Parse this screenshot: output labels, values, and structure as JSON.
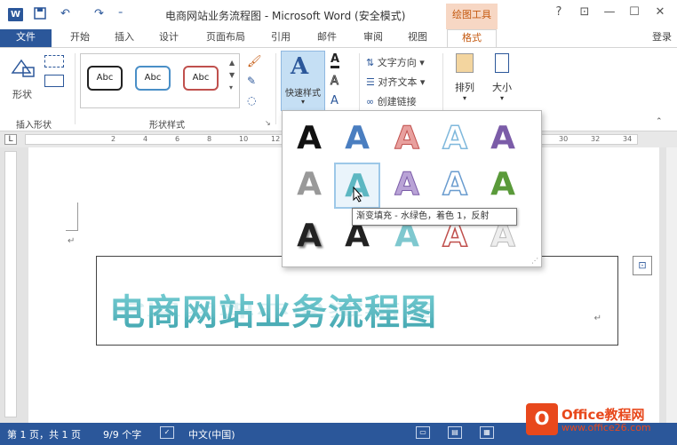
{
  "titlebar": {
    "app_icon": "W",
    "save_icon": "save-icon",
    "undo_icon": "undo-icon",
    "redo_icon": "redo-icon",
    "title": "电商网站业务流程图 - Microsoft Word (安全模式)",
    "contextual_tab": "绘图工具",
    "help": "?",
    "minimize": "—",
    "restore": "☐",
    "close": "✕",
    "ribbon_opts": "⊡"
  },
  "tabs": {
    "file": "文件",
    "items": [
      "开始",
      "插入",
      "设计",
      "页面布局",
      "引用",
      "邮件",
      "审阅",
      "视图"
    ],
    "format": "格式",
    "login": "登录"
  },
  "ribbon": {
    "insert_shape": {
      "shape_label": "形状",
      "group_label": "插入形状"
    },
    "shape_styles": {
      "samples": [
        "Abc",
        "Abc",
        "Abc"
      ],
      "group_label": "形状样式"
    },
    "wordart": {
      "quick_style_label": "快速样式",
      "text_direction": "文字方向",
      "align_text": "对齐文本",
      "create_link": "创建链接"
    },
    "arrange_label": "排列",
    "size_label": "大小",
    "accent_colors": {
      "blue": "#2b579a",
      "orange": "#c55a11"
    }
  },
  "ruler": {
    "corner": "L",
    "ticks": [
      "2",
      "4",
      "6",
      "8",
      "10",
      "12",
      "14",
      "16",
      "18",
      "20",
      "22",
      "24",
      "26",
      "28",
      "30",
      "32",
      "34"
    ]
  },
  "document": {
    "para_mark": "↵",
    "wordart_text": "电商网站业务流程图",
    "box_para_mark": "↵"
  },
  "gallery": {
    "rows": [
      [
        "A",
        "A",
        "A",
        "A",
        "A"
      ],
      [
        "A",
        "A",
        "A",
        "A",
        "A"
      ],
      [
        "A",
        "A",
        "A",
        "A",
        "A"
      ]
    ],
    "tooltip": "渐变填充 - 水绿色，着色 1，反射"
  },
  "statusbar": {
    "page": "第 1 页，共 1 页",
    "words": "9/9 个字",
    "language": "中文(中国)"
  },
  "watermark": {
    "logo": "O",
    "text": "Office教程网",
    "url": "www.office26.com"
  }
}
